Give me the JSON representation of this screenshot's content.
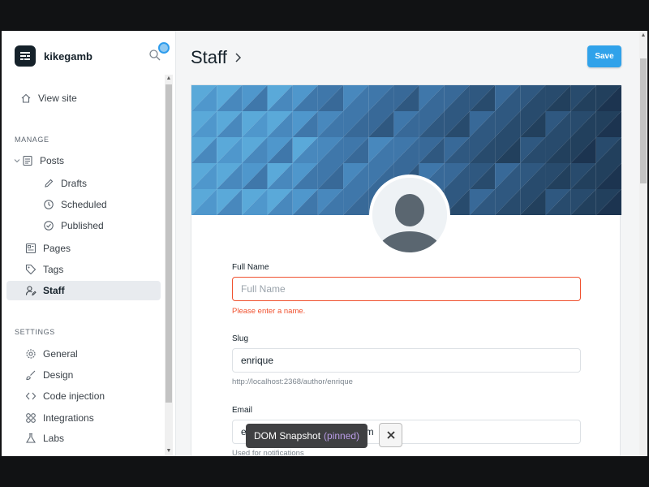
{
  "brand": {
    "name": "kikegamb"
  },
  "sidebar": {
    "view_site": "View site",
    "manage_label": "MANAGE",
    "posts": "Posts",
    "drafts": "Drafts",
    "scheduled": "Scheduled",
    "published": "Published",
    "pages": "Pages",
    "tags": "Tags",
    "staff": "Staff",
    "settings_label": "SETTINGS",
    "general": "General",
    "design": "Design",
    "code_injection": "Code injection",
    "integrations": "Integrations",
    "labs": "Labs"
  },
  "header": {
    "title": "Staff",
    "save_label": "Save"
  },
  "form": {
    "full_name": {
      "label": "Full Name",
      "placeholder": "Full Name",
      "value": "",
      "error": "Please enter a name."
    },
    "slug": {
      "label": "Slug",
      "value": "enrique",
      "hint": "http://localhost:2368/author/enrique"
    },
    "email": {
      "label": "Email",
      "value": "enriquegamb9418@gmail.com",
      "hint": "Used for notifications"
    }
  },
  "toast": {
    "text": "DOM Snapshot",
    "status": "(pinned)"
  },
  "colors": {
    "accent": "#30a2ea",
    "error": "#f05230",
    "sidebar_active": "#e8ebef"
  }
}
